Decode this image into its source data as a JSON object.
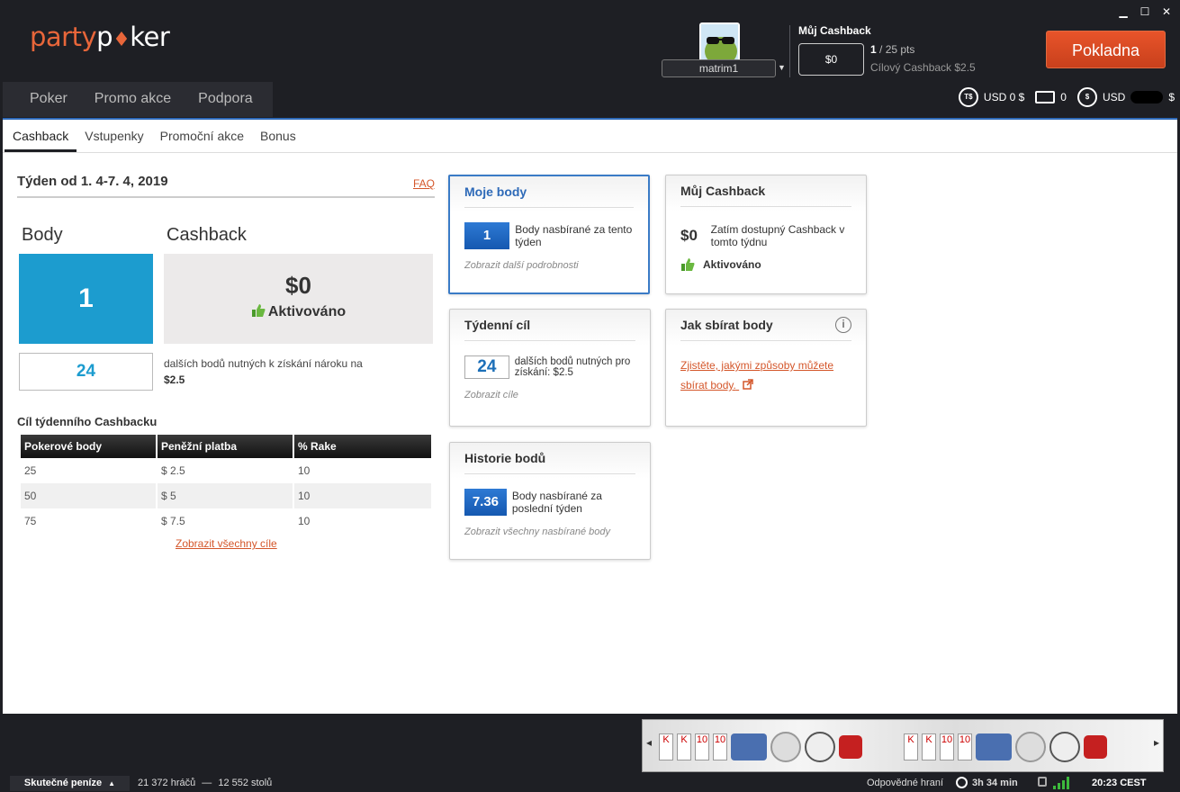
{
  "window": {
    "minimize": "▁",
    "maximize": "☐",
    "close": "✕"
  },
  "brand": {
    "part1": "party",
    "part2": "p",
    "part3": "ker"
  },
  "user": {
    "username": "matrim1"
  },
  "header_cashback": {
    "title": "Můj Cashback",
    "amount": "$0",
    "points_current": "1",
    "points_total": "/ 25 pts",
    "target": "Cílový Cashback $2.5"
  },
  "cashier_button": "Pokladna",
  "main_nav": [
    "Poker",
    "Promo akce",
    "Podpora"
  ],
  "balances": {
    "ts_icon": "T$",
    "ts": "USD 0 $",
    "tickets": "0",
    "cash_icon": "$",
    "cash_prefix": "USD",
    "cash_suffix": "$"
  },
  "subtabs": [
    "Cashback",
    "Vstupenky",
    "Promoční akce",
    "Bonus"
  ],
  "week": {
    "title": "Týden od 1. 4-7. 4, 2019",
    "faq": "FAQ"
  },
  "summary": {
    "points_label": "Body",
    "cashback_label": "Cashback",
    "points": "1",
    "cashback": "$0",
    "activated": "Aktivováno",
    "needed": "24",
    "needed_text": "dalších bodů nutných k získání nároku na",
    "needed_amount": "$2.5"
  },
  "goals": {
    "title": "Cíl týdenního Cashbacku",
    "headers": [
      "Pokerové body",
      "Peněžní platba",
      "% Rake"
    ],
    "rows": [
      [
        "25",
        "$ 2.5",
        "10"
      ],
      [
        "50",
        "$ 5",
        "10"
      ],
      [
        "75",
        "$ 7.5",
        "10"
      ]
    ],
    "show_all": "Zobrazit všechny cíle"
  },
  "cards": {
    "my_points": {
      "title": "Moje body",
      "value": "1",
      "text": "Body nasbírané za tento týden",
      "link": "Zobrazit další podrobnosti"
    },
    "my_cashback": {
      "title": "Můj Cashback",
      "value": "$0",
      "text": "Zatím dostupný Cashback v tomto týdnu",
      "status": "Aktivováno"
    },
    "weekly_goal": {
      "title": "Týdenní cíl",
      "value": "24",
      "text": "dalších bodů nutných pro získání: $2.5",
      "link": "Zobrazit cíle"
    },
    "how_to": {
      "title": "Jak sbírat body",
      "info": "i",
      "link": "Zjistěte, jakými způsoby můžete sbírat body."
    },
    "history": {
      "title": "Historie bodů",
      "value": "7.36",
      "text": "Body nasbírané za poslední týden",
      "link": "Zobrazit všechny nasbírané body"
    }
  },
  "footer": {
    "real_money": "Skutečné peníze",
    "players": "21 372 hráčů",
    "sep": "—",
    "tables": "12 552 stolů",
    "responsible": "Odpovědné hraní",
    "session": "3h 34 min",
    "time": "20:23 CEST"
  },
  "colors": {
    "accent": "#e8542a",
    "blue": "#1c9ccf",
    "link": "#d4562a"
  }
}
